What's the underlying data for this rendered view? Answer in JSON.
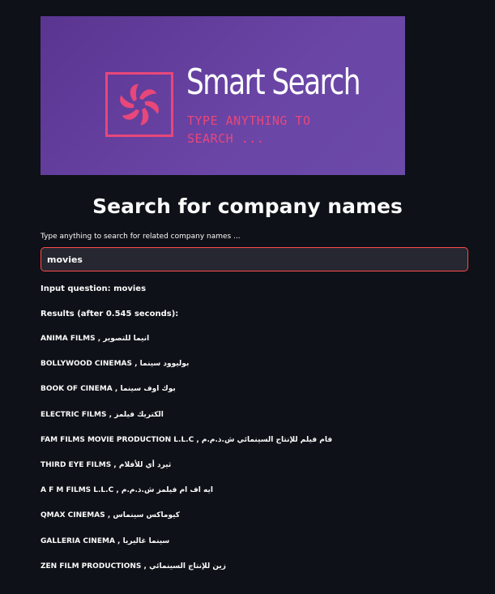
{
  "banner": {
    "title": "Smart Search",
    "subtitle": "TYPE ANYTHING TO SEARCH ..."
  },
  "page": {
    "heading": "Search for company names",
    "input_label": "Type anything to search for related company names ..."
  },
  "search": {
    "value": "movies"
  },
  "output": {
    "question_line": "Input question: movies",
    "results_line": "Results (after 0.545 seconds):"
  },
  "results": [
    "ANIMA FILMS , انيما للتصوير",
    "BOLLYWOOD CINEMAS , بوليوود سينما",
    "BOOK OF CINEMA , بوك اوف سينما",
    "ELECTRIC FILMS , الكتريك فيلمز",
    "FAM FILMS MOVIE PRODUCTION L.L.C , فام فيلم للإنتاج السينمائي ش.ذ.م.م",
    "THIRD EYE FILMS , ثيرد أي للأفلام",
    "A F M FILMS L.L.C , ايه اف ام فيلمز ش.ذ.م.م",
    "QMAX CINEMAS , كيوماكس سينماس",
    "GALLERIA CINEMA , سينما غاليريا",
    "ZEN FILM PRODUCTIONS , زين للإنتاج السينمائي"
  ],
  "colors": {
    "background": "#0e1117",
    "input_background": "#262730",
    "input_border": "#ff4b4b",
    "banner_purple": "#6a45a6",
    "logo_pink": "#e8477a"
  }
}
